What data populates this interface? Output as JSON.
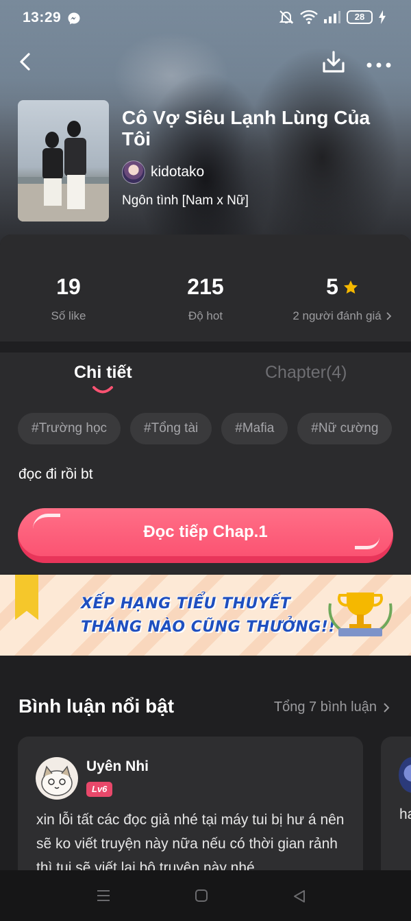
{
  "status_bar": {
    "time": "13:29",
    "battery": "28"
  },
  "story": {
    "title": "Cô Vợ Siêu Lạnh Lùng Của Tôi",
    "author": "kidotako",
    "genre": "Ngôn tình [Nam x Nữ]"
  },
  "stats": {
    "likes_value": "19",
    "likes_label": "Số like",
    "hot_value": "215",
    "hot_label": "Độ hot",
    "rating_value": "5",
    "rating_label": "2 người đánh giá"
  },
  "tabs": {
    "detail": "Chi tiết",
    "chapter": "Chapter(4)"
  },
  "tags": [
    "#Trường học",
    "#Tổng tài",
    "#Mafia",
    "#Nữ cường"
  ],
  "description": "đọc đi rồi bt",
  "read_button": "Đọc tiếp Chap.1",
  "banner": {
    "line1": "XẾP HẠNG TIỂU THUYẾT",
    "line2": "THÁNG NÀO CŨNG THƯỞNG!!"
  },
  "comments": {
    "title": "Bình luận nổi bật",
    "total": "Tổng 7 bình luận",
    "items": [
      {
        "name": "Uyên Nhi",
        "level": "Lv6",
        "text": "xin lỗi tất các đọc giả nhé tại máy tui bị hư á nên sẽ ko viết truyện này nữa nếu có thời gian rảnh thì tui sẽ viết lại bộ truyện này nhé"
      }
    ],
    "peek_text": "ha"
  },
  "colors": {
    "accent": "#fb5372",
    "star": "#f5b800",
    "background": "#1f1f21",
    "card": "#2b2b2d"
  },
  "icons": [
    "messenger-icon",
    "mute-icon",
    "wifi-icon",
    "signal-icon",
    "charging-icon",
    "back-icon",
    "download-icon",
    "more-icon",
    "star-icon",
    "chevron-right-icon",
    "trophy-icon"
  ]
}
